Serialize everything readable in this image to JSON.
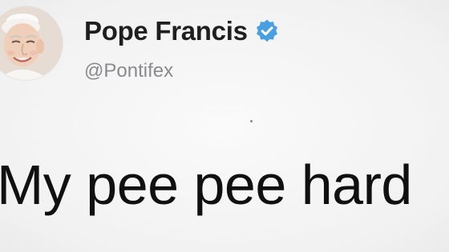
{
  "author": {
    "display_name": "Pope Francis",
    "handle": "@Pontifex",
    "verified": true,
    "avatar_icon": "profile-photo",
    "verified_icon": "verified-badge-icon"
  },
  "tweet": {
    "text": "My pee pee hard"
  },
  "colors": {
    "verified_badge": "#4a9fe0",
    "name": "#1f1f1f",
    "handle": "#888a8d",
    "text": "#101010",
    "background": "#f3f3f3"
  }
}
